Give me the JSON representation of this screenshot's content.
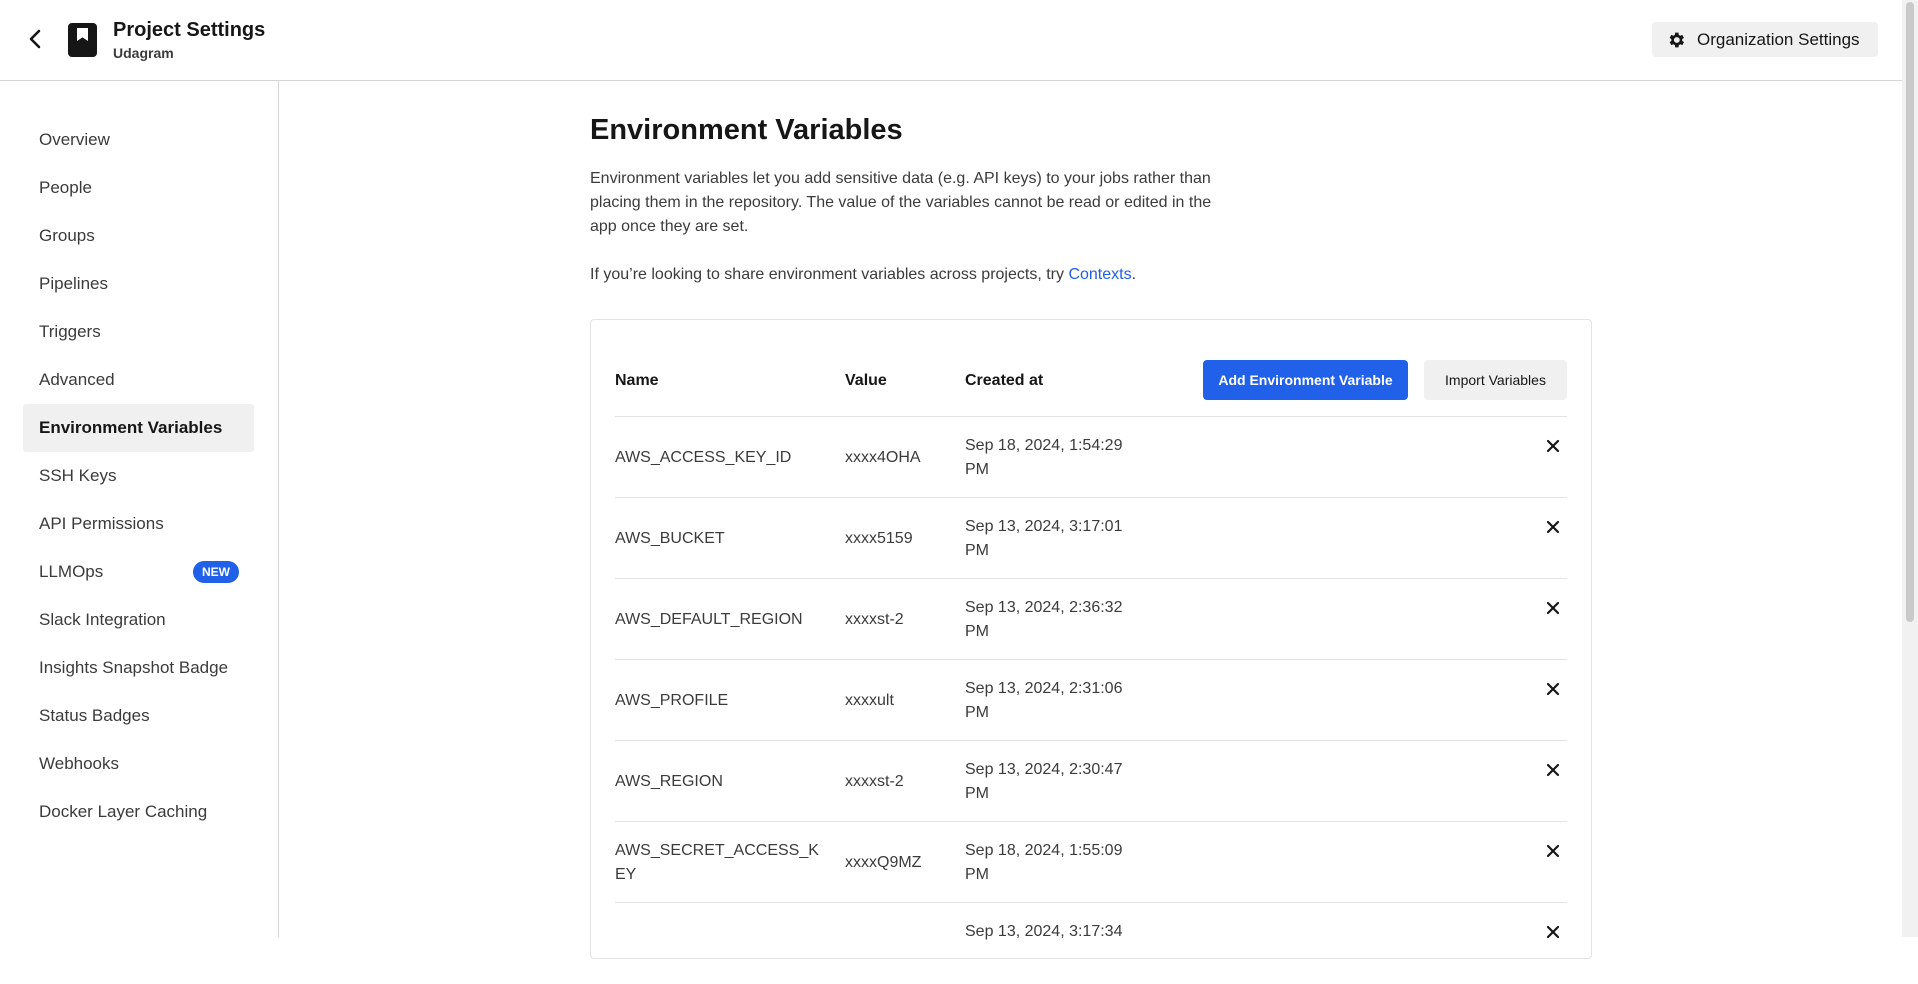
{
  "header": {
    "back_icon": "chevron-left-icon",
    "project_icon": "bookmark-book-icon",
    "title": "Project Settings",
    "subtitle": "Udagram",
    "org_button_icon": "gear-icon",
    "org_button_label": "Organization Settings"
  },
  "sidebar": {
    "items": [
      {
        "label": "Overview"
      },
      {
        "label": "People"
      },
      {
        "label": "Groups"
      },
      {
        "label": "Pipelines"
      },
      {
        "label": "Triggers"
      },
      {
        "label": "Advanced"
      },
      {
        "label": "Environment Variables",
        "active": true
      },
      {
        "label": "SSH Keys"
      },
      {
        "label": "API Permissions"
      },
      {
        "label": "LLMOps",
        "badge": "NEW"
      },
      {
        "label": "Slack Integration"
      },
      {
        "label": "Insights Snapshot Badge"
      },
      {
        "label": "Status Badges"
      },
      {
        "label": "Webhooks"
      },
      {
        "label": "Docker Layer Caching"
      }
    ]
  },
  "main": {
    "title": "Environment Variables",
    "description": "Environment variables let you add sensitive data (e.g. API keys) to your jobs rather than placing them in the repository. The value of the variables cannot be read or edited in the app once they are set.",
    "contexts_prefix": "If you’re looking to share environment variables across projects, try ",
    "contexts_link": "Contexts",
    "contexts_suffix": "."
  },
  "table": {
    "columns": {
      "name": "Name",
      "value": "Value",
      "created": "Created at"
    },
    "add_button": "Add Environment Variable",
    "import_button": "Import Variables",
    "delete_icon": "close-icon",
    "rows": [
      {
        "name": "AWS_ACCESS_KEY_ID",
        "value": "xxxx4OHA",
        "created": "Sep 18, 2024, 1:54:29 PM"
      },
      {
        "name": "AWS_BUCKET",
        "value": "xxxx5159",
        "created": "Sep 13, 2024, 3:17:01 PM"
      },
      {
        "name": "AWS_DEFAULT_REGION",
        "value": "xxxxst-2",
        "created": "Sep 13, 2024, 2:36:32 PM"
      },
      {
        "name": "AWS_PROFILE",
        "value": "xxxxult",
        "created": "Sep 13, 2024, 2:31:06 PM"
      },
      {
        "name": "AWS_REGION",
        "value": "xxxxst-2",
        "created": "Sep 13, 2024, 2:30:47 PM"
      },
      {
        "name": "AWS_SECRET_ACCESS_KEY",
        "value": "xxxxQ9MZ",
        "created": "Sep 18, 2024, 1:55:09 PM"
      },
      {
        "name": "",
        "value": "",
        "created": "Sep 13, 2024, 3:17:34"
      }
    ]
  },
  "colors": {
    "accent": "#2160e9",
    "active_bg": "#f0f0f0",
    "border": "#e3e3e3"
  }
}
